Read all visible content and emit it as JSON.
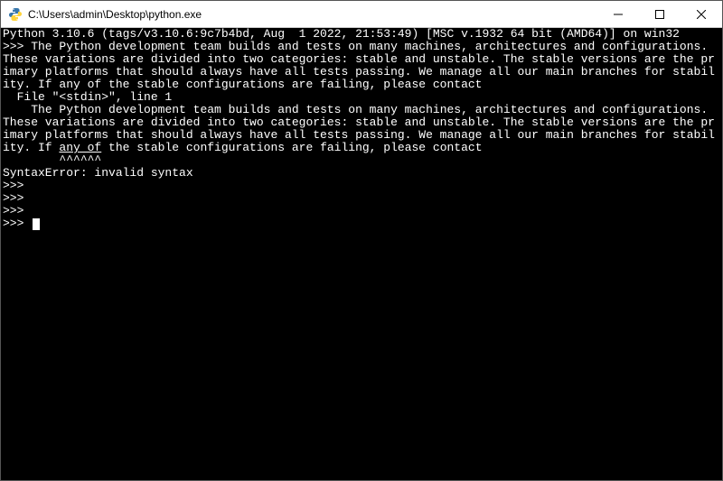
{
  "titlebar": {
    "path": "C:\\Users\\admin\\Desktop\\python.exe",
    "minimize_icon": "minimize",
    "maximize_icon": "maximize",
    "close_icon": "close"
  },
  "terminal": {
    "version_line": "Python 3.10.6 (tags/v3.10.6:9c7b4bd, Aug  1 2022, 21:53:49) [MSC v.1932 64 bit (AMD64)] on win32",
    "prompt": ">>>",
    "input_text": " The Python development team builds and tests on many machines, architectures and configurations. These variations are divided into two categories: stable and unstable. The stable versions are the primary platforms that should always have all tests passing. We manage all our main branches for stability. If any of the stable configurations are failing, please contact",
    "echo_line1": "  File \"<stdin>\", line 1",
    "echo_indent": "    The Python development team builds and tests on many machines, architectures and configurations. These variations are divided into two categories: stable and unstable. The stable versions are the primary platforms that should always have all tests passing. We manage all our main branches for stability. If ",
    "echo_underlined": "any of",
    "echo_after": " the stable configurations are failing, please contact",
    "caret_line": "        ^^^^^^",
    "error_line": "SyntaxError: invalid syntax",
    "empty_prompt": ">>>"
  }
}
